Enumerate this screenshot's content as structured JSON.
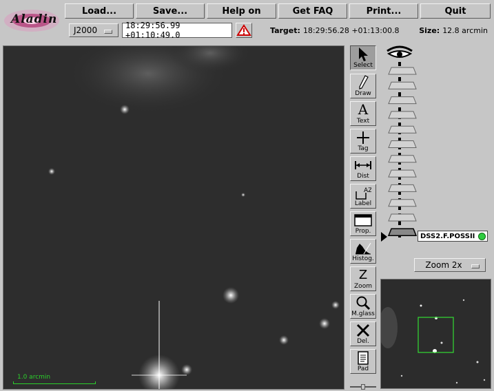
{
  "app": {
    "logo_text": "Aladin"
  },
  "menu": {
    "load": "Load...",
    "save": "Save...",
    "help": "Help on",
    "faq": "Get FAQ",
    "print": "Print...",
    "quit": "Quit"
  },
  "frame": {
    "value": "J2000"
  },
  "position": {
    "value": "18:29:56.99 +01:10:49.0"
  },
  "target": {
    "label": "Target:",
    "value": "18:29:56.28 +01:13:00.8"
  },
  "size": {
    "label": "Size:",
    "value": "12.8 arcmin"
  },
  "tools": [
    {
      "label": "Select",
      "icon": "arrow-pointer-icon"
    },
    {
      "label": "Draw",
      "icon": "pencil-icon"
    },
    {
      "label": "Text",
      "icon": "letter-a-icon"
    },
    {
      "label": "Tag",
      "icon": "plus-crosshair-icon"
    },
    {
      "label": "Dist",
      "icon": "distance-icon"
    },
    {
      "label": "Label",
      "icon": "label-az-icon"
    },
    {
      "label": "Prop.",
      "icon": "window-icon"
    },
    {
      "label": "Histog.",
      "icon": "histogram-icon"
    },
    {
      "label": "Zoom",
      "icon": "letter-z-icon"
    },
    {
      "label": "M.glass",
      "icon": "magnifier-icon"
    },
    {
      "label": "Del.",
      "icon": "x-delete-icon"
    },
    {
      "label": "Pad",
      "icon": "notepad-icon"
    }
  ],
  "layers": {
    "active_label": "DSS2.F.POSSII",
    "status_color": "#2ecc40"
  },
  "zoom": {
    "value": "Zoom 2x"
  },
  "scale_bar": {
    "label": "1.0 arcmin"
  },
  "colors": {
    "panel": "#c6c6c6",
    "scale": "#2bd12b",
    "thumb_box": "#33dd33"
  }
}
